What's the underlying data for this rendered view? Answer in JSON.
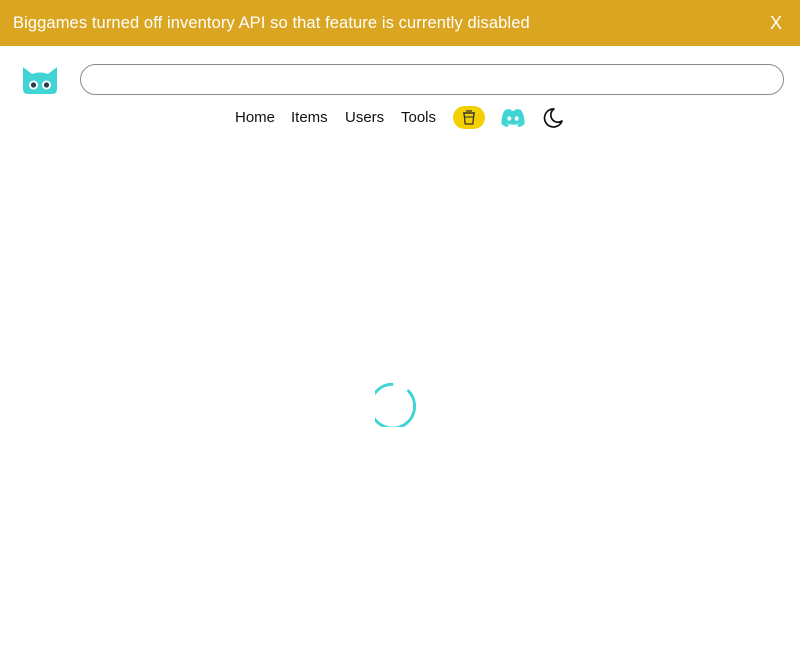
{
  "banner": {
    "message": "Biggames turned off inventory API so that feature is currently disabled",
    "close_label": "X",
    "color": "#daa520"
  },
  "header": {
    "logo_icon": "cat-logo-icon",
    "search": {
      "value": "",
      "placeholder": ""
    }
  },
  "nav": {
    "links": [
      {
        "label": "Home"
      },
      {
        "label": "Items"
      },
      {
        "label": "Users"
      },
      {
        "label": "Tools"
      }
    ],
    "donate_icon": "cup-icon",
    "discord_icon": "discord-icon",
    "theme_icon": "moon-icon"
  },
  "main": {
    "loading_indicator": "spinner",
    "accent": "#40d4d4"
  }
}
